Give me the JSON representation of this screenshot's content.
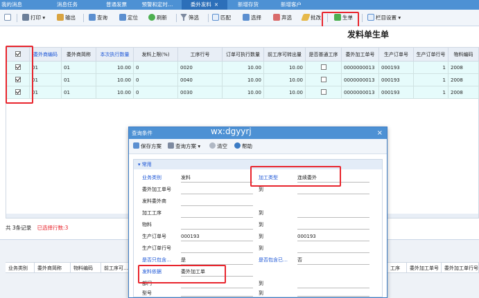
{
  "tabs": [
    {
      "label": "我的消息",
      "active": false
    },
    {
      "label": "消息任务",
      "active": false
    },
    {
      "label": "普通发票",
      "active": false
    },
    {
      "label": "预警和定时…",
      "active": false
    },
    {
      "label": "委外发料",
      "active": true,
      "close": "×"
    },
    {
      "label": "新增存货",
      "active": false
    },
    {
      "label": "新增客户",
      "active": false
    }
  ],
  "toolbar": {
    "print": "打印",
    "export": "输出",
    "query": "查询",
    "locate": "定位",
    "refresh": "刷新",
    "filter": "筛选",
    "match": "匹配",
    "select": "选择",
    "deselect": "弃选",
    "batch_change": "批改",
    "generate": "生单",
    "column_settings": "栏目设置"
  },
  "page_title": "发料单生单",
  "grid": {
    "headers": [
      "委外商编码",
      "委外商简称",
      "本次执行数量",
      "发料上限(%)",
      "工序行号",
      "订单可执行数量",
      "前工序可转出量",
      "是否普通工序",
      "委外加工单号",
      "生产订单号",
      "生产订单行号",
      "物料编码"
    ],
    "header_blue": [
      true,
      false,
      true,
      false,
      false,
      false,
      false,
      false,
      false,
      false,
      false,
      false
    ],
    "rows": [
      {
        "checked": true,
        "cells": [
          "01",
          "01",
          "10.00",
          "0",
          "0020",
          "10.00",
          "10.00",
          "",
          "0000000013",
          "000193",
          "1",
          "2008"
        ]
      },
      {
        "checked": true,
        "cells": [
          "01",
          "01",
          "10.00",
          "0",
          "0040",
          "10.00",
          "10.00",
          "",
          "0000000013",
          "000193",
          "1",
          "2008"
        ]
      },
      {
        "checked": true,
        "cells": [
          "01",
          "01",
          "10.00",
          "0",
          "0030",
          "10.00",
          "10.00",
          "",
          "0000000013",
          "000193",
          "1",
          "2008"
        ]
      }
    ]
  },
  "status": {
    "total": "共 3条记录",
    "selected": "已选择行数:3"
  },
  "bottom_headers": [
    "业务类别",
    "委外商简称",
    "物料编码",
    "前工序可…"
  ],
  "bottom_headers_right": [
    "工序",
    "委外加工单号",
    "委外加工单行号"
  ],
  "dialog": {
    "title": "查询条件",
    "watermark": "wx:dgyyrj",
    "close": "×",
    "save_scheme": "保存方案",
    "query_scheme": "查询方案",
    "clear": "清空",
    "help": "帮助",
    "section": "常用",
    "fields": [
      {
        "label": "业务类别",
        "value": "发料",
        "blue": true
      },
      {
        "label": "委外加工单号",
        "value": "",
        "to": "到",
        "to_value": ""
      },
      {
        "label": "发料委外商",
        "value": ""
      },
      {
        "label": "加工工序",
        "value": "",
        "to": "到",
        "to_value": ""
      },
      {
        "label": "物料",
        "value": "",
        "to": "到",
        "to_value": ""
      },
      {
        "label": "生产订单号",
        "value": "000193",
        "to": "到",
        "to_value": "000193"
      },
      {
        "label": "生产订单行号",
        "value": "",
        "to": "到",
        "to_value": ""
      },
      {
        "label": "是否只包含…",
        "value": "是",
        "blue": true,
        "to": "是否包含已…",
        "to_value": "否",
        "to_blue": true
      },
      {
        "label": "发料依据",
        "value": "委外加工单",
        "blue": true
      },
      {
        "label": "部门",
        "value": "",
        "to": "到",
        "to_value": ""
      },
      {
        "label": "型号",
        "value": "",
        "to": "到",
        "to_value": ""
      }
    ],
    "process_type_label": "加工类型",
    "process_type_value": "连续委外"
  },
  "colors": {
    "tab_blue": "#4d91d4",
    "active_tab": "#2c6fb9",
    "row_bg": "#e6fbfb",
    "highlight": "#e8242c",
    "link_blue": "#1b55d6"
  }
}
